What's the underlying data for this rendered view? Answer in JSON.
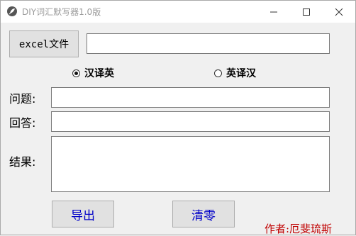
{
  "window": {
    "title": "DIY词汇默写器1.0版",
    "controls": {
      "minimize_icon": "minimize-icon",
      "maximize_icon": "maximize-icon",
      "close_icon": "close-icon"
    }
  },
  "file": {
    "button_label": "excel文件",
    "path_value": ""
  },
  "mode": {
    "options": [
      {
        "label": "汉译英",
        "selected": true
      },
      {
        "label": "英译汉",
        "selected": false
      }
    ]
  },
  "fields": {
    "question_label": "问题:",
    "question_value": "",
    "answer_label": "回答:",
    "answer_value": "",
    "result_label": "结果:",
    "result_value": ""
  },
  "actions": {
    "export_label": "导出",
    "clear_label": "清零"
  },
  "footer": {
    "author": "作者:厄斐琉斯"
  },
  "colors": {
    "action_text": "#0000c8",
    "author_text": "#c00000",
    "title_text": "#9a9a9a"
  }
}
